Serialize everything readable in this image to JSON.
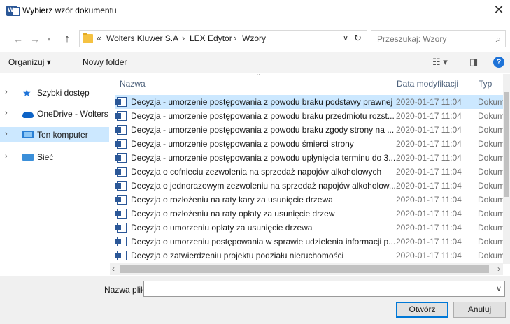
{
  "window": {
    "title": "Wybierz wzór dokumentu",
    "app_icon_letter": "W",
    "close_glyph": "✕"
  },
  "address": {
    "breadcrumbs": [
      "Wolters Kluwer S.A",
      "LEX Edytor",
      "Wzory"
    ],
    "overflow": "«",
    "separator": "›",
    "search_placeholder": "Przeszukaj: Wzory"
  },
  "toolbar": {
    "organize": "Organizuj ▾",
    "new_folder": "Nowy folder",
    "help": "?"
  },
  "nav": {
    "items": [
      {
        "label": "Szybki dostęp",
        "icon": "star-icon"
      },
      {
        "label": "OneDrive - Wolters",
        "icon": "cloud-icon"
      },
      {
        "label": "Ten komputer",
        "icon": "computer-icon"
      },
      {
        "label": "Sieć",
        "icon": "network-icon"
      }
    ]
  },
  "list": {
    "columns": [
      "Nazwa",
      "Data modyfikacji",
      "Typ"
    ],
    "rows": [
      {
        "name": "Decyzja - umorzenie postępowania z powodu braku podstawy prawnej",
        "date": "2020-01-17 11:04",
        "type": "Dokum"
      },
      {
        "name": "Decyzja - umorzenie postępowania z powodu braku przedmiotu rozst...",
        "date": "2020-01-17 11:04",
        "type": "Dokum"
      },
      {
        "name": "Decyzja - umorzenie postępowania z powodu braku zgody strony na ...",
        "date": "2020-01-17 11:04",
        "type": "Dokum"
      },
      {
        "name": "Decyzja - umorzenie postępowania z powodu śmierci strony",
        "date": "2020-01-17 11:04",
        "type": "Dokum"
      },
      {
        "name": "Decyzja - umorzenie postępowania z powodu upłynięcia terminu do 3...",
        "date": "2020-01-17 11:04",
        "type": "Dokum"
      },
      {
        "name": "Decyzja o cofnieciu zezwolenia na sprzedaż napojów alkoholowych",
        "date": "2020-01-17 11:04",
        "type": "Dokum"
      },
      {
        "name": "Decyzja o jednorazowym zezwoleniu na sprzedaż napojów alkoholow...",
        "date": "2020-01-17 11:04",
        "type": "Dokum"
      },
      {
        "name": "Decyzja o rozłożeniu na raty kary za usunięcie drzewa",
        "date": "2020-01-17 11:04",
        "type": "Dokum"
      },
      {
        "name": "Decyzja o rozłożeniu na raty opłaty za usunięcie drzew",
        "date": "2020-01-17 11:04",
        "type": "Dokum"
      },
      {
        "name": "Decyzja o umorzeniu opłaty za usunięcie drzewa",
        "date": "2020-01-17 11:04",
        "type": "Dokum"
      },
      {
        "name": "Decyzja o umorzeniu postępowania w sprawie udzielenia informacji p...",
        "date": "2020-01-17 11:04",
        "type": "Dokum"
      },
      {
        "name": "Decyzja o zatwierdzeniu projektu podziału nieruchomości",
        "date": "2020-01-17 11:04",
        "type": "Dokum"
      }
    ]
  },
  "footer": {
    "filename_label": "Nazwa pliku:",
    "filename_value": "",
    "open_button": "Otwórz",
    "cancel_button": "Anuluj"
  }
}
